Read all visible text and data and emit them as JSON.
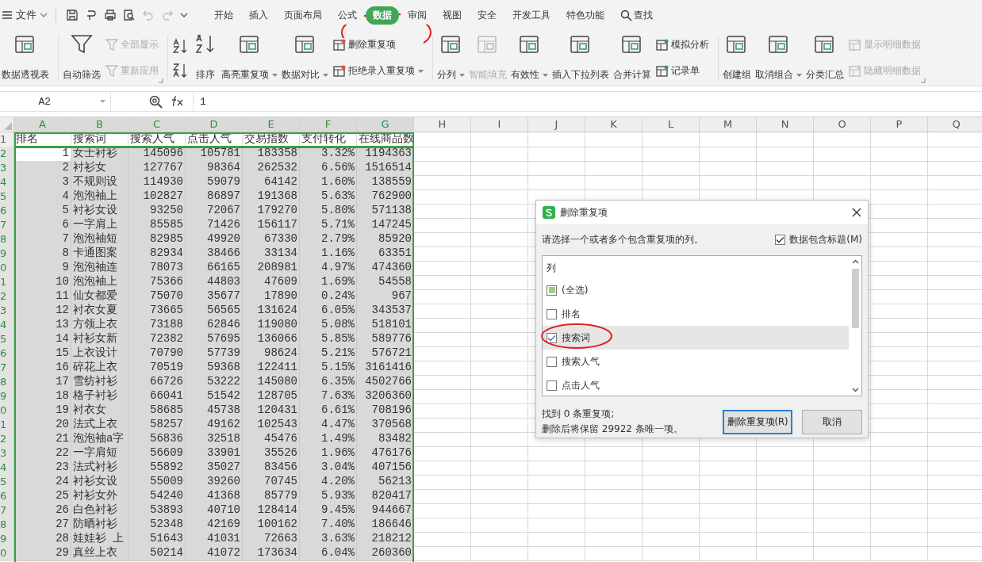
{
  "menu_bar": {
    "file_label": "文件",
    "tabs": [
      {
        "label": "开始",
        "selected": false
      },
      {
        "label": "插入",
        "selected": false
      },
      {
        "label": "页面布局",
        "selected": false
      },
      {
        "label": "公式",
        "selected": false
      },
      {
        "label": "数据",
        "selected": true
      },
      {
        "label": "审阅",
        "selected": false
      },
      {
        "label": "视图",
        "selected": false
      },
      {
        "label": "安全",
        "selected": false
      },
      {
        "label": "开发工具",
        "selected": false
      },
      {
        "label": "特色功能",
        "selected": false
      }
    ],
    "search_label": "查找"
  },
  "ribbon": {
    "groups": [
      {
        "launcher": false,
        "items": [
          {
            "kind": "large",
            "label": "数据透视表",
            "dropdown": false,
            "disabled": false
          }
        ]
      },
      {
        "launcher": true,
        "items": [
          {
            "kind": "large",
            "label": "自动筛选",
            "dropdown": false,
            "disabled": false
          },
          {
            "kind": "stack",
            "entries": [
              {
                "label": "全部显示",
                "dropdown": false,
                "disabled": true
              },
              {
                "label": "重新应用",
                "dropdown": false,
                "disabled": true
              }
            ]
          }
        ]
      },
      {
        "launcher": false,
        "items": [
          {
            "kind": "sort-icons"
          },
          {
            "kind": "large",
            "label": "排序",
            "dropdown": false,
            "disabled": false
          },
          {
            "kind": "large",
            "label": "高亮重复项",
            "dropdown": true,
            "disabled": false
          },
          {
            "kind": "large",
            "label": "数据对比",
            "dropdown": true,
            "disabled": false
          },
          {
            "kind": "stack",
            "entries": [
              {
                "label": "删除重复项",
                "dropdown": false,
                "disabled": false
              },
              {
                "label": "拒绝录入重复项",
                "dropdown": true,
                "disabled": false
              }
            ]
          }
        ]
      },
      {
        "launcher": false,
        "items": [
          {
            "kind": "large",
            "label": "分列",
            "dropdown": true,
            "disabled": false
          },
          {
            "kind": "large",
            "label": "智能填充",
            "dropdown": false,
            "disabled": true
          },
          {
            "kind": "large",
            "label": "有效性",
            "dropdown": true,
            "disabled": false
          },
          {
            "kind": "large",
            "label": "插入下拉列表",
            "dropdown": false,
            "disabled": false
          },
          {
            "kind": "large",
            "label": "合并计算",
            "dropdown": false,
            "disabled": false
          },
          {
            "kind": "stack",
            "entries": [
              {
                "label": "模拟分析",
                "dropdown": false,
                "disabled": false
              },
              {
                "label": "记录单",
                "dropdown": false,
                "disabled": false
              }
            ]
          }
        ]
      },
      {
        "launcher": true,
        "items": [
          {
            "kind": "large",
            "label": "创建组",
            "dropdown": false,
            "disabled": false
          },
          {
            "kind": "large",
            "label": "取消组合",
            "dropdown": true,
            "disabled": false
          },
          {
            "kind": "large",
            "label": "分类汇总",
            "dropdown": false,
            "disabled": false
          },
          {
            "kind": "stack",
            "entries": [
              {
                "label": "显示明细数据",
                "dropdown": false,
                "disabled": true
              },
              {
                "label": "隐藏明细数据",
                "dropdown": false,
                "disabled": true
              }
            ]
          }
        ]
      }
    ]
  },
  "formula_bar": {
    "name_box": "A2",
    "value": "1"
  },
  "sheet": {
    "columns": [
      {
        "label": "A",
        "selected": true
      },
      {
        "label": "B",
        "selected": true
      },
      {
        "label": "C",
        "selected": true
      },
      {
        "label": "D",
        "selected": true
      },
      {
        "label": "E",
        "selected": true
      },
      {
        "label": "F",
        "selected": true
      },
      {
        "label": "G",
        "selected": true
      },
      {
        "label": "H",
        "selected": false
      },
      {
        "label": "I",
        "selected": false
      },
      {
        "label": "J",
        "selected": false
      },
      {
        "label": "K",
        "selected": false
      },
      {
        "label": "L",
        "selected": false
      },
      {
        "label": "M",
        "selected": false
      },
      {
        "label": "N",
        "selected": false
      },
      {
        "label": "O",
        "selected": false
      },
      {
        "label": "P",
        "selected": false
      },
      {
        "label": "Q",
        "selected": false
      }
    ],
    "rows": [
      {
        "number": "1",
        "kind": "header",
        "selected": false,
        "cells": [
          "排名",
          "搜索词",
          "搜索人气",
          "点击人气",
          "交易指数",
          "支付转化",
          "在线商品数"
        ]
      },
      {
        "number": "2",
        "kind": "data",
        "selected": true,
        "active": true,
        "cells": [
          "1",
          "女士衬衫",
          "145096",
          "105781",
          "183358",
          "3.32%",
          "1194363"
        ]
      },
      {
        "number": "3",
        "kind": "data",
        "selected": true,
        "active": false,
        "cells": [
          "2",
          "衬衫女",
          "127767",
          "98364",
          "262532",
          "6.56%",
          "1516514"
        ]
      },
      {
        "number": "4",
        "kind": "data",
        "selected": true,
        "active": false,
        "cells": [
          "3",
          "不规则设",
          "114930",
          "59079",
          "64142",
          "1.60%",
          "138559"
        ]
      },
      {
        "number": "5",
        "kind": "data",
        "selected": true,
        "active": false,
        "cells": [
          "4",
          "泡泡袖上",
          "102827",
          "86897",
          "191368",
          "5.63%",
          "762900"
        ]
      },
      {
        "number": "6",
        "kind": "data",
        "selected": true,
        "active": false,
        "cells": [
          "5",
          "衬衫女设",
          "93250",
          "72067",
          "179270",
          "5.80%",
          "571138"
        ]
      },
      {
        "number": "7",
        "kind": "data",
        "selected": true,
        "active": false,
        "cells": [
          "6",
          "一字肩上",
          "85585",
          "71426",
          "156117",
          "5.71%",
          "147245"
        ]
      },
      {
        "number": "8",
        "kind": "data",
        "selected": true,
        "active": false,
        "cells": [
          "7",
          "泡泡袖短",
          "82985",
          "49920",
          "67330",
          "2.79%",
          "85920"
        ]
      },
      {
        "number": "9",
        "kind": "data",
        "selected": true,
        "active": false,
        "cells": [
          "8",
          "卡通图案",
          "82934",
          "38466",
          "33134",
          "1.16%",
          "63351"
        ]
      },
      {
        "number": "0",
        "kind": "data",
        "selected": true,
        "active": false,
        "cells": [
          "9",
          "泡泡袖连",
          "78073",
          "66165",
          "208981",
          "4.97%",
          "474360"
        ]
      },
      {
        "number": "1",
        "kind": "data",
        "selected": true,
        "active": false,
        "cells": [
          "10",
          "泡泡袖上",
          "75366",
          "44803",
          "47609",
          "1.69%",
          "54558"
        ]
      },
      {
        "number": "2",
        "kind": "data",
        "selected": true,
        "active": false,
        "cells": [
          "11",
          "仙女都爱",
          "75070",
          "35677",
          "17890",
          "0.24%",
          "967"
        ]
      },
      {
        "number": "3",
        "kind": "data",
        "selected": true,
        "active": false,
        "cells": [
          "12",
          "衬衣女夏",
          "73665",
          "56565",
          "131624",
          "6.05%",
          "343537"
        ]
      },
      {
        "number": "4",
        "kind": "data",
        "selected": true,
        "active": false,
        "cells": [
          "13",
          "方领上衣",
          "73188",
          "62846",
          "119080",
          "5.08%",
          "518101"
        ]
      },
      {
        "number": "5",
        "kind": "data",
        "selected": true,
        "active": false,
        "cells": [
          "14",
          "衬衫女新",
          "72382",
          "57695",
          "136066",
          "5.85%",
          "589776"
        ]
      },
      {
        "number": "6",
        "kind": "data",
        "selected": true,
        "active": false,
        "cells": [
          "15",
          "上衣设计",
          "70790",
          "57739",
          "98624",
          "5.21%",
          "576721"
        ]
      },
      {
        "number": "7",
        "kind": "data",
        "selected": true,
        "active": false,
        "cells": [
          "16",
          "碎花上衣",
          "70519",
          "59368",
          "122411",
          "5.15%",
          "3161416"
        ]
      },
      {
        "number": "8",
        "kind": "data",
        "selected": true,
        "active": false,
        "cells": [
          "17",
          "雪纺衬衫",
          "66726",
          "53222",
          "145080",
          "6.35%",
          "4502766"
        ]
      },
      {
        "number": "9",
        "kind": "data",
        "selected": true,
        "active": false,
        "cells": [
          "18",
          "格子衬衫",
          "66041",
          "51542",
          "128705",
          "7.63%",
          "3206360"
        ]
      },
      {
        "number": "0",
        "kind": "data",
        "selected": true,
        "active": false,
        "cells": [
          "19",
          "衬衣女",
          "58685",
          "45738",
          "120431",
          "6.61%",
          "708196"
        ]
      },
      {
        "number": "1",
        "kind": "data",
        "selected": true,
        "active": false,
        "cells": [
          "20",
          "法式上衣",
          "58257",
          "49162",
          "102543",
          "4.47%",
          "370568"
        ]
      },
      {
        "number": "2",
        "kind": "data",
        "selected": true,
        "active": false,
        "cells": [
          "21",
          "泡泡袖a字",
          "56836",
          "32518",
          "45476",
          "1.49%",
          "83482"
        ]
      },
      {
        "number": "3",
        "kind": "data",
        "selected": true,
        "active": false,
        "cells": [
          "22",
          "一字肩短",
          "56609",
          "33901",
          "35526",
          "1.96%",
          "476176"
        ]
      },
      {
        "number": "4",
        "kind": "data",
        "selected": true,
        "active": false,
        "cells": [
          "23",
          "法式衬衫",
          "55892",
          "35027",
          "83456",
          "3.04%",
          "407156"
        ]
      },
      {
        "number": "5",
        "kind": "data",
        "selected": true,
        "active": false,
        "cells": [
          "24",
          "衬衫女设",
          "55009",
          "39260",
          "70745",
          "4.20%",
          "56213"
        ]
      },
      {
        "number": "6",
        "kind": "data",
        "selected": true,
        "active": false,
        "cells": [
          "25",
          "衬衫女外",
          "54240",
          "41368",
          "85779",
          "5.93%",
          "820417"
        ]
      },
      {
        "number": "7",
        "kind": "data",
        "selected": true,
        "active": false,
        "cells": [
          "26",
          "白色衬衫",
          "53893",
          "40710",
          "128414",
          "9.45%",
          "944667"
        ]
      },
      {
        "number": "8",
        "kind": "data",
        "selected": true,
        "active": false,
        "cells": [
          "27",
          "防晒衬衫",
          "52348",
          "42169",
          "100162",
          "7.40%",
          "186646"
        ]
      },
      {
        "number": "9",
        "kind": "data",
        "selected": true,
        "active": false,
        "cells": [
          "28",
          "娃娃衫 上",
          "51643",
          "41031",
          "72663",
          "3.63%",
          "218212"
        ]
      },
      {
        "number": "0",
        "kind": "data",
        "selected": true,
        "active": false,
        "cells": [
          "29",
          "真丝上衣",
          "50214",
          "41072",
          "173634",
          "6.04%",
          "260360"
        ]
      }
    ]
  },
  "dialog": {
    "title": "删除重复项",
    "prompt": "请选择一个或者多个包含重复项的列。",
    "header_option": {
      "label": "数据包含标题(M)",
      "checked": true
    },
    "list_header": "列",
    "items": [
      {
        "label": "(全选)",
        "checked": false,
        "mixed": true,
        "selected": false
      },
      {
        "label": "排名",
        "checked": false,
        "mixed": false,
        "selected": false
      },
      {
        "label": "搜索词",
        "checked": true,
        "mixed": false,
        "selected": true
      },
      {
        "label": "搜索人气",
        "checked": false,
        "mixed": false,
        "selected": false
      },
      {
        "label": "点击人气",
        "checked": false,
        "mixed": false,
        "selected": false
      }
    ],
    "found": "找到 0 条重复项;",
    "remaining": "删除后将保留 29922 条唯一项。",
    "buttons": [
      {
        "label": "删除重复项(R)",
        "default": true
      },
      {
        "label": "取消",
        "default": false
      }
    ]
  }
}
